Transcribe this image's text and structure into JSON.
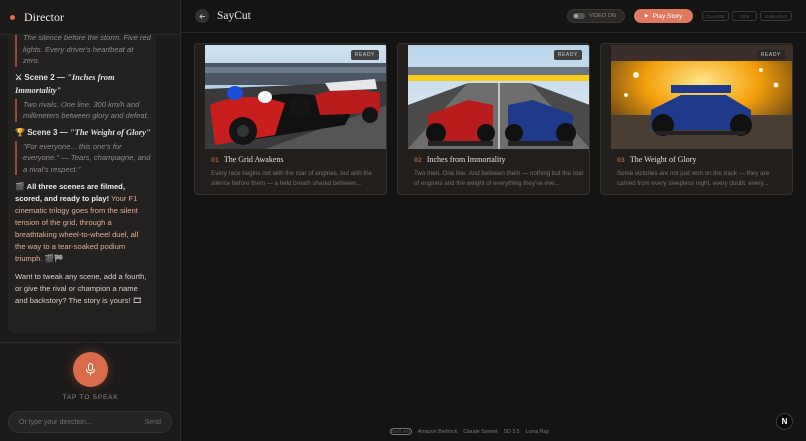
{
  "sidebar": {
    "title": "Director",
    "chat": {
      "intro_quote": "The silence before the storm. Five red lights. Every driver's heartbeat at zero.",
      "scene2_prefix": "Scene 2 —",
      "scene2_title": "\"Inches from Immortality\"",
      "scene2_quote": "Two rivals. One line. 300 km/h and millimeters between glory and defeat.",
      "scene3_prefix": "Scene 3 —",
      "scene3_title": "\"The Weight of Glory\"",
      "scene3_quote_italic": "\"For everyone... this one's for everyone.\"",
      "scene3_quote_rest": " — Tears, champagne, and a rival's respect.\"",
      "summary_bold": "All three scenes are filmed, scored, and ready to play!",
      "summary_rest": " Your F1 cinematic trilogy goes from the silent tension of the grid, through a breathtaking wheel-to-wheel duel, all the way to a tear-soaked podium triumph. 🎬🏁",
      "followup": "Want to tweak any scene, add a fourth, or give the rival or champion a name and backstory? The story is yours! 🎞"
    },
    "tap_to_speak": "TAP TO SPEAK",
    "input_placeholder": "Or type your direction...",
    "send_label": "Send"
  },
  "header": {
    "app_title": "SayCut",
    "video_toggle_label": "VIDEO ON",
    "play_label": "Play Story",
    "format_buttons": [
      "CLAUDE",
      "16:9",
      "LUMA RAY"
    ]
  },
  "cards": [
    {
      "badge": "READY",
      "number": "01",
      "title": "The Grid Awakens",
      "description": "Every race begins not with the roar of engines, but with the silence before them — a held breath shared between..."
    },
    {
      "badge": "READY",
      "number": "02",
      "title": "Inches from Immortality",
      "description": "Two men. One line. And between them — nothing but the roar of engines and the weight of everything they've eve..."
    },
    {
      "badge": "READY",
      "number": "03",
      "title": "The Weight of Glory",
      "description": "Some victories are not just won on the track — they are carved from every sleepless night, every doubt, every..."
    }
  ],
  "footer": {
    "built_with": "Built with",
    "items": [
      "Amazon Bedrock",
      "Claude Sonnet",
      "SD 3.5",
      "Luma Ray"
    ]
  },
  "badge_logo": "N",
  "colors": {
    "accent": "#e07a5f",
    "background": "#141414",
    "sidebar": "#1c1b1a"
  }
}
